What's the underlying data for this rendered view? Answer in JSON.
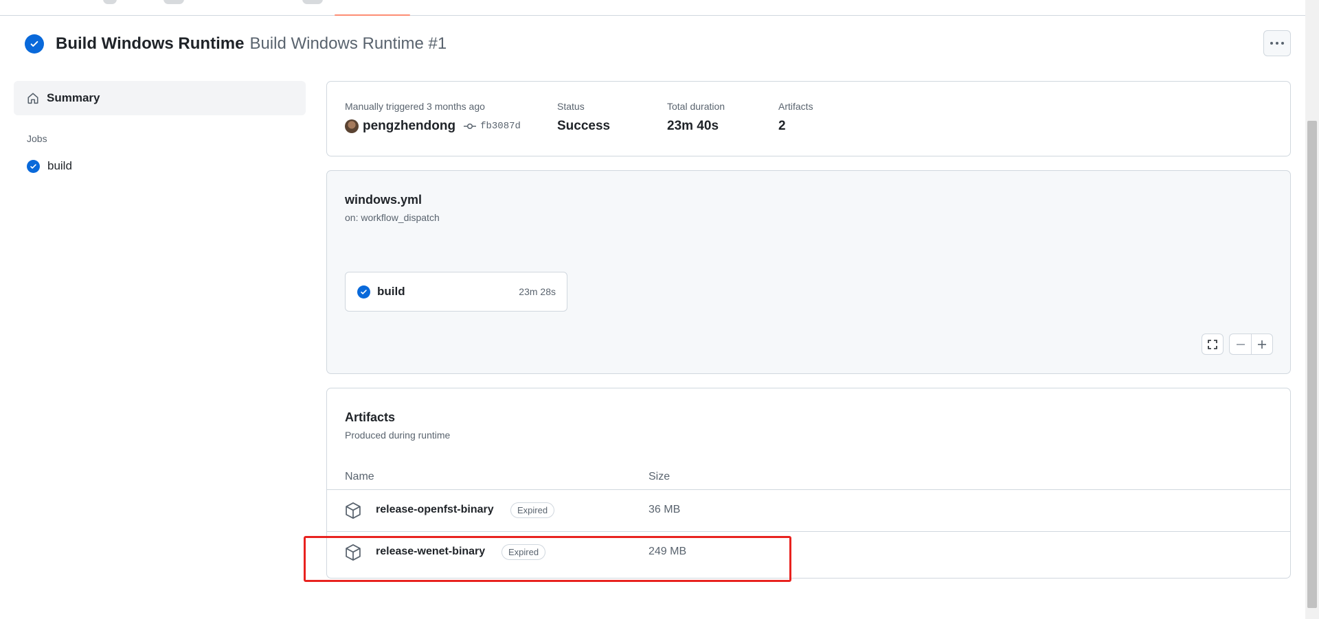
{
  "header": {
    "workflow_name": "Build Windows Runtime",
    "run_title": "Build Windows Runtime #1",
    "more_label": "More actions"
  },
  "sidebar": {
    "summary_label": "Summary",
    "jobs_label": "Jobs",
    "jobs": [
      {
        "label": "build",
        "status": "success"
      }
    ]
  },
  "summary": {
    "trigger_text": "Manually triggered 3 months ago",
    "actor": "pengzhendong",
    "commit_sha": "fb3087d",
    "status_label": "Status",
    "status_value": "Success",
    "duration_label": "Total duration",
    "duration_value": "23m 40s",
    "artifacts_label": "Artifacts",
    "artifacts_value": "2"
  },
  "graph": {
    "workflow_file": "windows.yml",
    "trigger": "on: workflow_dispatch",
    "job_name": "build",
    "job_duration": "23m 28s"
  },
  "artifacts": {
    "title": "Artifacts",
    "subtitle": "Produced during runtime",
    "col_name": "Name",
    "col_size": "Size",
    "rows": [
      {
        "name": "release-openfst-binary",
        "badge": "Expired",
        "size": "36 MB"
      },
      {
        "name": "release-wenet-binary",
        "badge": "Expired",
        "size": "249 MB"
      }
    ]
  },
  "colors": {
    "accent_blue": "#0969da",
    "highlight_red": "#e8221f",
    "tab_underline": "#fd8c73"
  },
  "icons": [
    "check-circle-icon",
    "home-icon",
    "commit-icon",
    "package-icon",
    "fullscreen-icon",
    "zoom-out-icon",
    "zoom-in-icon",
    "kebab-horizontal-icon"
  ]
}
